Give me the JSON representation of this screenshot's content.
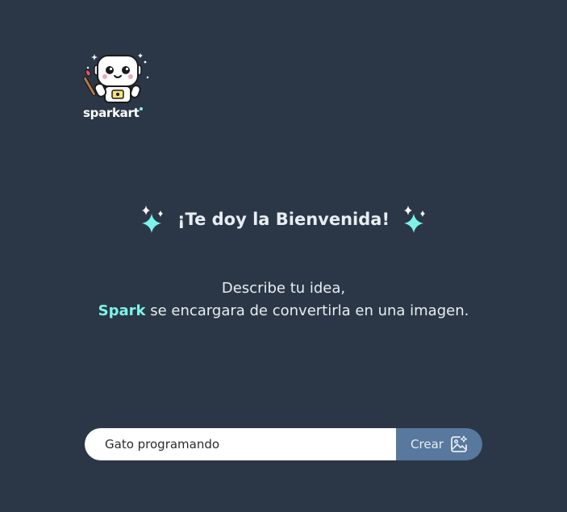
{
  "logo": {
    "text": "sparkart",
    "icon": "robot-artist-icon"
  },
  "welcome": {
    "heading": "¡Te doy la Bienvenida!",
    "icon": "sparkles-icon"
  },
  "description": {
    "line1": "Describe tu idea,",
    "brand": "Spark",
    "line2": " se encargara de convertirla en una imagen."
  },
  "prompt": {
    "value": "Gato programando",
    "button_label": "Crear",
    "button_icon": "image-sparkle-icon"
  },
  "colors": {
    "background": "#2b3746",
    "accent": "#7df3ea",
    "button": "#58789d"
  }
}
